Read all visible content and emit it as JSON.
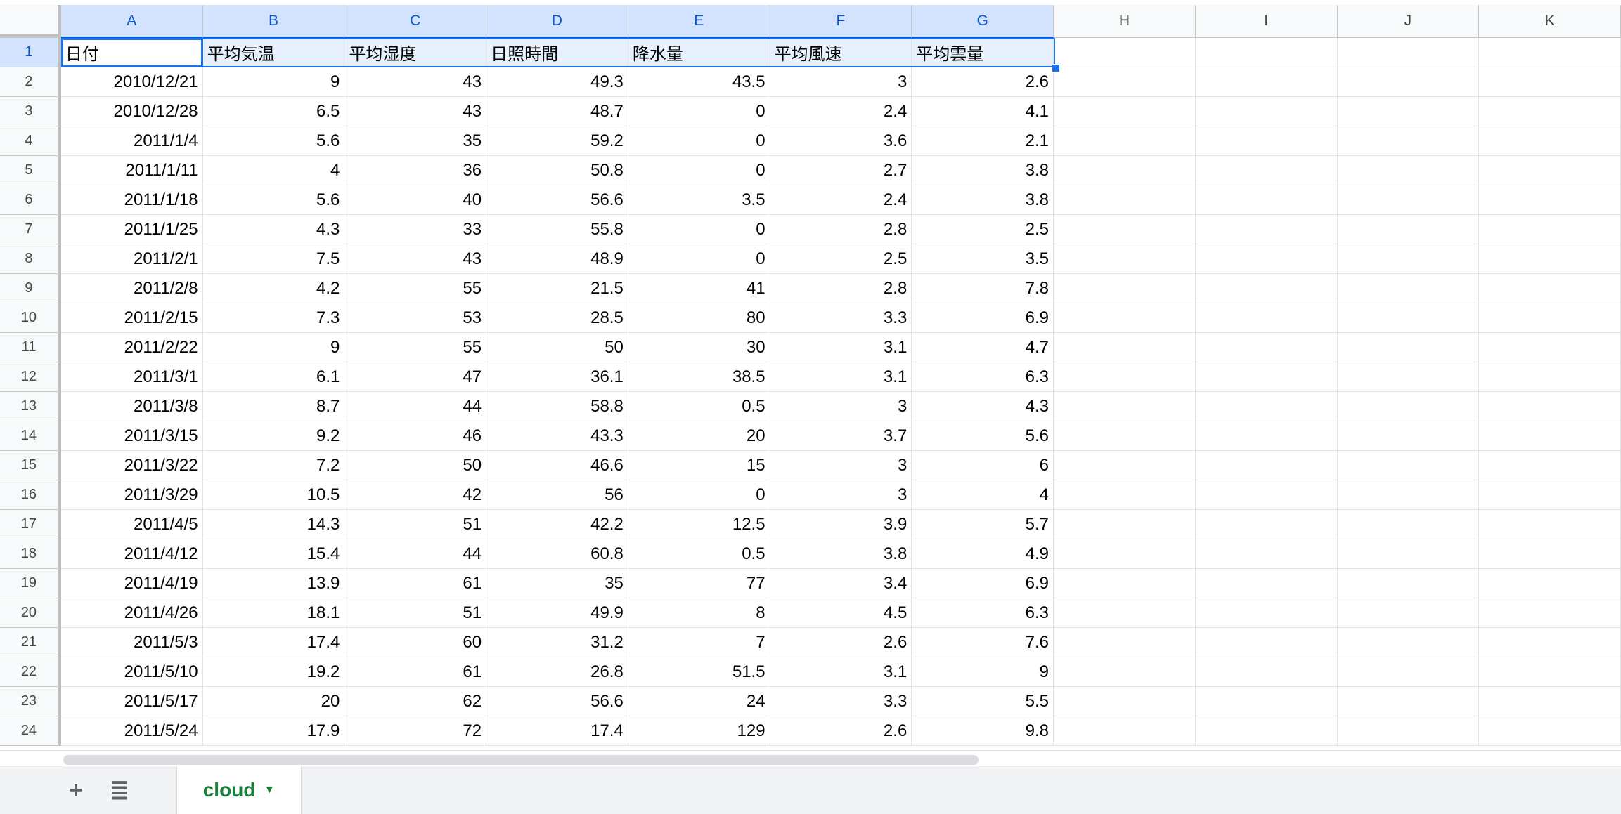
{
  "columns": [
    "A",
    "B",
    "C",
    "D",
    "E",
    "F",
    "G",
    "H",
    "I",
    "J",
    "K"
  ],
  "headers": [
    "日付",
    "平均気温",
    "平均湿度",
    "日照時間",
    "降水量",
    "平均風速",
    "平均雲量"
  ],
  "rows": [
    [
      "2010/12/21",
      "9",
      "43",
      "49.3",
      "43.5",
      "3",
      "2.6"
    ],
    [
      "2010/12/28",
      "6.5",
      "43",
      "48.7",
      "0",
      "2.4",
      "4.1"
    ],
    [
      "2011/1/4",
      "5.6",
      "35",
      "59.2",
      "0",
      "3.6",
      "2.1"
    ],
    [
      "2011/1/11",
      "4",
      "36",
      "50.8",
      "0",
      "2.7",
      "3.8"
    ],
    [
      "2011/1/18",
      "5.6",
      "40",
      "56.6",
      "3.5",
      "2.4",
      "3.8"
    ],
    [
      "2011/1/25",
      "4.3",
      "33",
      "55.8",
      "0",
      "2.8",
      "2.5"
    ],
    [
      "2011/2/1",
      "7.5",
      "43",
      "48.9",
      "0",
      "2.5",
      "3.5"
    ],
    [
      "2011/2/8",
      "4.2",
      "55",
      "21.5",
      "41",
      "2.8",
      "7.8"
    ],
    [
      "2011/2/15",
      "7.3",
      "53",
      "28.5",
      "80",
      "3.3",
      "6.9"
    ],
    [
      "2011/2/22",
      "9",
      "55",
      "50",
      "30",
      "3.1",
      "4.7"
    ],
    [
      "2011/3/1",
      "6.1",
      "47",
      "36.1",
      "38.5",
      "3.1",
      "6.3"
    ],
    [
      "2011/3/8",
      "8.7",
      "44",
      "58.8",
      "0.5",
      "3",
      "4.3"
    ],
    [
      "2011/3/15",
      "9.2",
      "46",
      "43.3",
      "20",
      "3.7",
      "5.6"
    ],
    [
      "2011/3/22",
      "7.2",
      "50",
      "46.6",
      "15",
      "3",
      "6"
    ],
    [
      "2011/3/29",
      "10.5",
      "42",
      "56",
      "0",
      "3",
      "4"
    ],
    [
      "2011/4/5",
      "14.3",
      "51",
      "42.2",
      "12.5",
      "3.9",
      "5.7"
    ],
    [
      "2011/4/12",
      "15.4",
      "44",
      "60.8",
      "0.5",
      "3.8",
      "4.9"
    ],
    [
      "2011/4/19",
      "13.9",
      "61",
      "35",
      "77",
      "3.4",
      "6.9"
    ],
    [
      "2011/4/26",
      "18.1",
      "51",
      "49.9",
      "8",
      "4.5",
      "6.3"
    ],
    [
      "2011/5/3",
      "17.4",
      "60",
      "31.2",
      "7",
      "2.6",
      "7.6"
    ],
    [
      "2011/5/10",
      "19.2",
      "61",
      "26.8",
      "51.5",
      "3.1",
      "9"
    ],
    [
      "2011/5/17",
      "20",
      "62",
      "56.6",
      "24",
      "3.3",
      "5.5"
    ],
    [
      "2011/5/24",
      "17.9",
      "72",
      "17.4",
      "129",
      "2.6",
      "9.8"
    ]
  ],
  "sheet_tab": {
    "label": "cloud"
  },
  "icons": {
    "add_sheet": "plus-icon",
    "all_sheets": "list-icon",
    "tab_menu": "caret-down-icon"
  },
  "colors": {
    "selection": "#1a73e8",
    "tab_text": "#188038"
  }
}
